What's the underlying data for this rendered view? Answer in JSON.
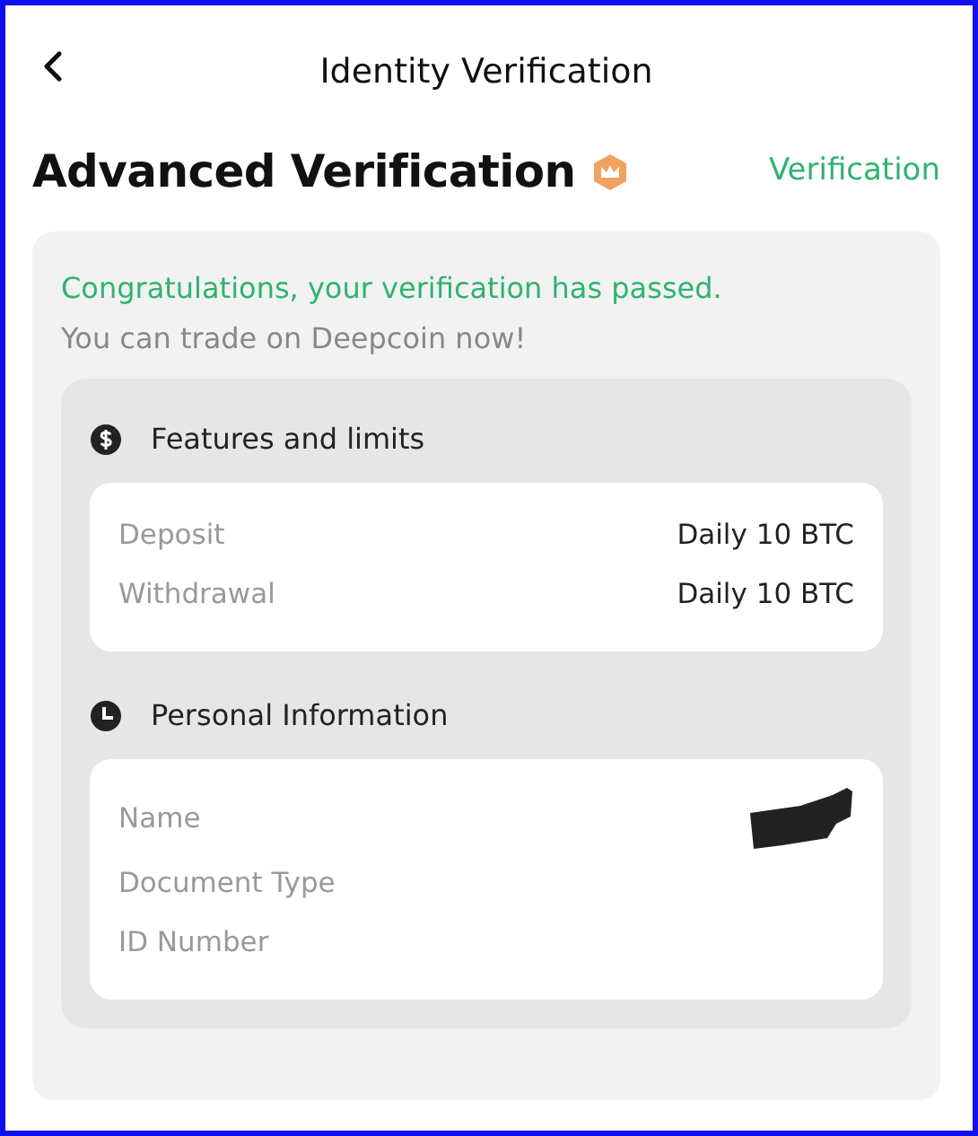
{
  "header": {
    "title": "Identity Verification"
  },
  "page": {
    "title": "Advanced Verification",
    "link": "Verification"
  },
  "status": {
    "headline": "Congratulations, your verification has passed.",
    "subline": "You can trade on Deepcoin now!"
  },
  "sections": [
    {
      "kind": "limits",
      "title": "Features and limits",
      "rows": [
        {
          "label": "Deposit",
          "value": "Daily 10 BTC"
        },
        {
          "label": "Withdrawal",
          "value": "Daily 10 BTC"
        }
      ]
    },
    {
      "kind": "personal",
      "title": "Personal Information",
      "rows": [
        {
          "label": "Name",
          "redacted": true
        },
        {
          "label": "Document Type",
          "redacted": false
        },
        {
          "label": "ID Number",
          "redacted": false
        }
      ]
    }
  ]
}
